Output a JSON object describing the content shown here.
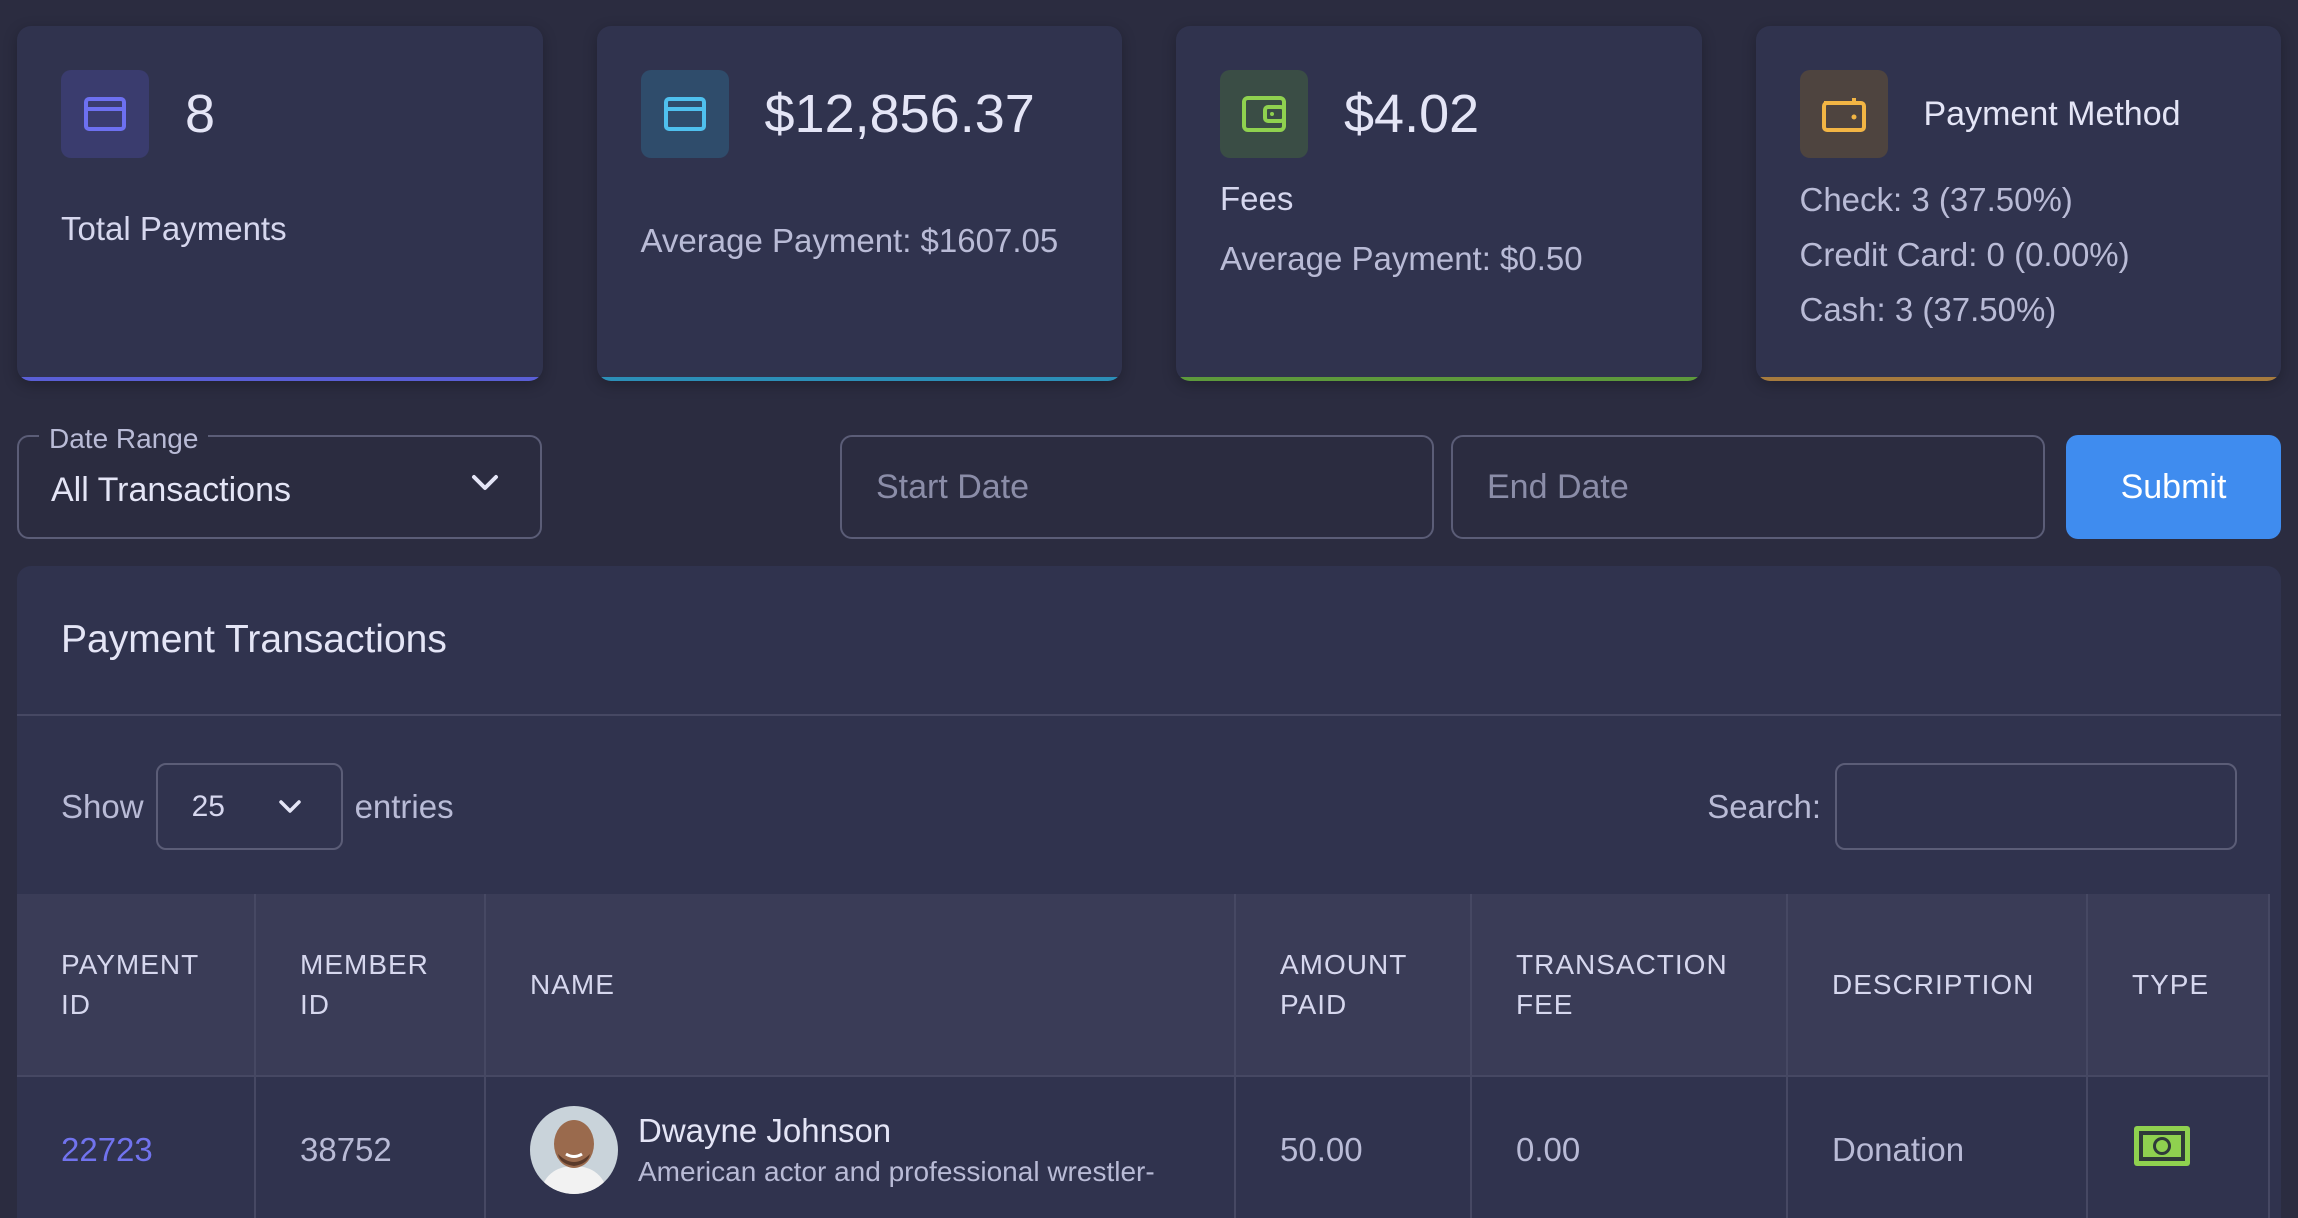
{
  "stats": {
    "total_payments": {
      "value": "8",
      "label": "Total Payments",
      "icon": "card-icon",
      "color": "#6d70f0"
    },
    "amount": {
      "value": "$12,856.37",
      "sub": "Average Payment: $1607.05",
      "icon": "card-icon",
      "color": "#4fc0ee"
    },
    "fees": {
      "value": "$4.02",
      "label": "Fees",
      "sub": "Average Payment: $0.50",
      "icon": "wallet-icon",
      "color": "#8fd14f"
    },
    "payment_method": {
      "title": "Payment Method",
      "icon": "wallet-icon",
      "color": "#f2b544",
      "lines": [
        "Check: 3 (37.50%)",
        "Credit Card: 0 (0.00%)",
        "Cash: 3 (37.50%)"
      ]
    }
  },
  "filters": {
    "date_range_label": "Date Range",
    "date_range_value": "All Transactions",
    "start_placeholder": "Start Date",
    "end_placeholder": "End Date",
    "submit_label": "Submit"
  },
  "panel": {
    "title": "Payment Transactions",
    "show_label": "Show",
    "entries_value": "25",
    "entries_label": "entries",
    "search_label": "Search:"
  },
  "table": {
    "headers": [
      "PAYMENT ID",
      "MEMBER ID",
      "NAME",
      "AMOUNT PAID",
      "TRANSACTION FEE",
      "DESCRIPTION",
      "TYPE"
    ],
    "rows": [
      {
        "payment_id": "22723",
        "member_id": "38752",
        "name": "Dwayne Johnson",
        "subtitle": "American actor and professional wrestler-",
        "amount": "50.00",
        "fee": "0.00",
        "description": "Donation",
        "type_icon": "cash-icon"
      }
    ]
  }
}
